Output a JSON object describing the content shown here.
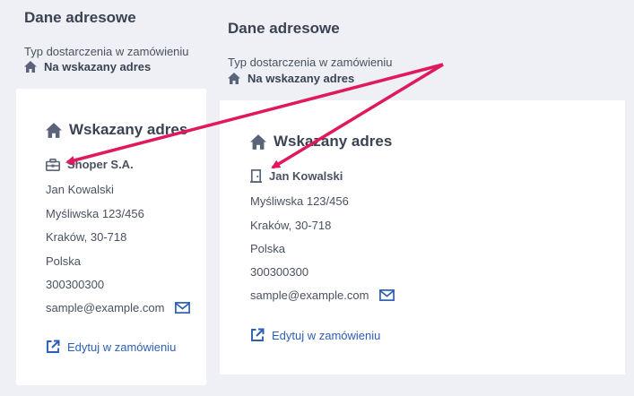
{
  "left": {
    "section_title": "Dane adresowe",
    "delivery_label": "Typ dostarczenia w zamówieniu",
    "delivery_value": "Na wskazany adres",
    "card": {
      "title": "Wskazany adres",
      "company": "Shoper S.A.",
      "lines": [
        "Jan Kowalski",
        "Myśliwska 123/456",
        "Kraków, 30-718",
        "Polska",
        "300300300"
      ],
      "email": "sample@example.com",
      "edit_label": "Edytuj w zamówieniu"
    }
  },
  "right": {
    "section_title": "Dane adresowe",
    "delivery_label": "Typ dostarczenia w zamówieniu",
    "delivery_value": "Na wskazany adres",
    "card": {
      "title": "Wskazany adres",
      "name": "Jan Kowalski",
      "lines": [
        "Myśliwska 123/456",
        "Kraków, 30-718",
        "Polska",
        "300300300"
      ],
      "email": "sample@example.com",
      "edit_label": "Edytuj w zamówieniu"
    }
  },
  "colors": {
    "panel_bg": "#eef0f5",
    "card_bg": "#ffffff",
    "text": "#4a5160",
    "heading": "#3b4252",
    "icon": "#5a6378",
    "link": "#2c5fb3",
    "arrow": "#e0195d"
  },
  "icons": {
    "delivery": "home-icon",
    "company": "briefcase-icon",
    "person": "door-icon",
    "email": "envelope-icon",
    "edit": "external-link-icon"
  }
}
